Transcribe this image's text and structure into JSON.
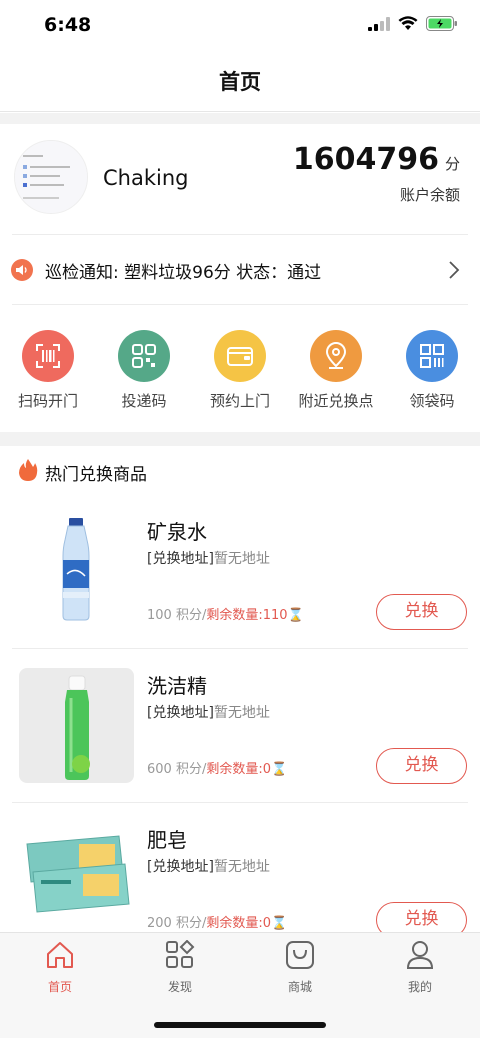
{
  "status_bar": {
    "time": "6:48"
  },
  "nav": {
    "title": "首页"
  },
  "account": {
    "username": "Chaking",
    "balance": "1604796",
    "balance_unit": "分",
    "balance_label": "账户余额"
  },
  "notice": {
    "text": "巡检通知: 塑料垃圾96分 状态：通过"
  },
  "quick_actions": [
    {
      "label": "扫码开门",
      "color": "#ef6a5e",
      "icon": "scan-icon"
    },
    {
      "label": "投递码",
      "color": "#55a888",
      "icon": "qrcode-icon"
    },
    {
      "label": "预约上门",
      "color": "#f5c445",
      "icon": "wallet-icon"
    },
    {
      "label": "附近兑换点",
      "color": "#ef9a40",
      "icon": "location-icon"
    },
    {
      "label": "领袋码",
      "color": "#4a8ee0",
      "icon": "barcode-icon"
    }
  ],
  "hot": {
    "title": "热门兑换商品"
  },
  "products": [
    {
      "name": "矿泉水",
      "addr_label": "[兑换地址]",
      "addr_value": "暂无地址",
      "points": "100 积分/",
      "remaining": "剩余数量:110",
      "button": "兑换"
    },
    {
      "name": "洗洁精",
      "addr_label": "[兑换地址]",
      "addr_value": "暂无地址",
      "points": "600 积分/",
      "remaining": "剩余数量:0",
      "button": "兑换"
    },
    {
      "name": "肥皂",
      "addr_label": "[兑换地址]",
      "addr_value": "暂无地址",
      "points": "200 积分/",
      "remaining": "剩余数量:0",
      "button": "兑换"
    }
  ],
  "tabbar": [
    {
      "label": "首页",
      "icon": "home-icon",
      "active": true
    },
    {
      "label": "发现",
      "icon": "discover-icon",
      "active": false
    },
    {
      "label": "商城",
      "icon": "shop-icon",
      "active": false
    },
    {
      "label": "我的",
      "icon": "profile-icon",
      "active": false
    }
  ],
  "colors": {
    "accent": "#e25950",
    "band": "#f2f2f2"
  }
}
